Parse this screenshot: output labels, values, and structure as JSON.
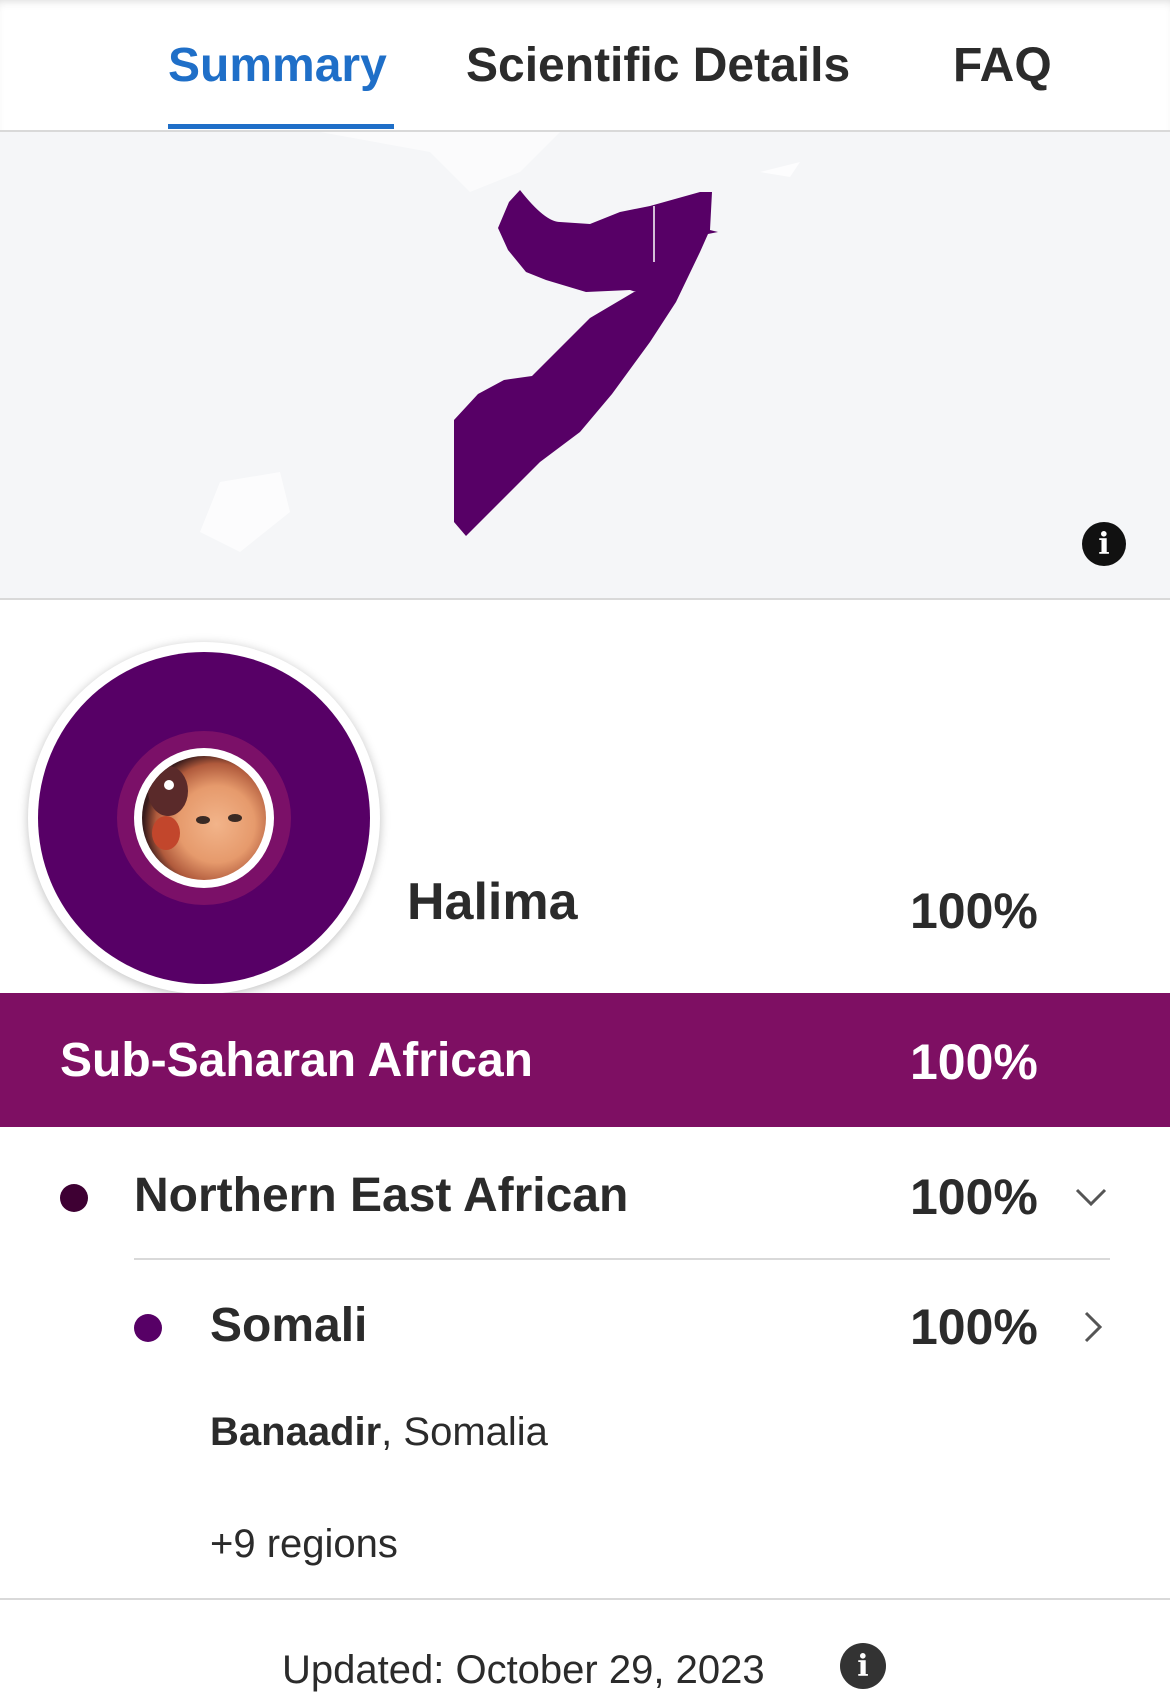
{
  "tabs": [
    {
      "label": "Summary",
      "active": true
    },
    {
      "label": "Scientific Details",
      "active": false
    },
    {
      "label": "FAQ",
      "active": false
    }
  ],
  "map": {
    "highlight_color": "#570066",
    "land_color": "#ffffff",
    "water_color": "#f5f6f8",
    "info_icon": "info-icon"
  },
  "profile": {
    "name": "Halima",
    "percent": "100%",
    "avatar": "avatar-photo"
  },
  "ancestry": {
    "group": {
      "label": "Sub-Saharan African",
      "percent": "100%",
      "color": "#7e0f63"
    },
    "region": {
      "label": "Northern East African",
      "percent": "100%",
      "dot_color": "#3e0033",
      "icon": "chevron-down-icon"
    },
    "population": {
      "label": "Somali",
      "percent": "100%",
      "dot_color": "#570066",
      "icon": "chevron-right-icon"
    },
    "location_bold": "Banaadir",
    "location_rest": ", Somalia",
    "more_regions": "+9 regions"
  },
  "footer": {
    "updated": "Updated: October 29, 2023",
    "icon": "info-icon"
  }
}
